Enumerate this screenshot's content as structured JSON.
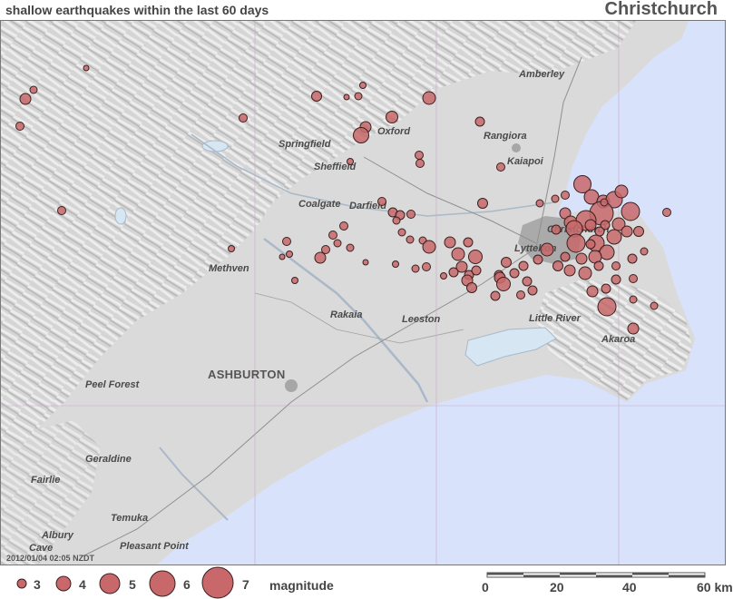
{
  "header": {
    "subtitle": "shallow earthquakes within the last 60 days",
    "title": "Christchurch"
  },
  "map": {
    "timestamp": "2012/01/04 02:05 NZDT",
    "colors": {
      "land": "#dadada",
      "sea": "#d8e2fa",
      "quake_fill": "#c8686b",
      "lake": "#d6e6f2"
    },
    "places": [
      {
        "name": "Amberley",
        "type": "town"
      },
      {
        "name": "Oxford",
        "type": "town"
      },
      {
        "name": "Springfield",
        "type": "town"
      },
      {
        "name": "Rangiora",
        "type": "town"
      },
      {
        "name": "Sheffield",
        "type": "town"
      },
      {
        "name": "Kaiapoi",
        "type": "town"
      },
      {
        "name": "Coalgate",
        "type": "town"
      },
      {
        "name": "Darfield",
        "type": "town"
      },
      {
        "name": "Christchurch",
        "type": "town"
      },
      {
        "name": "Lyttelton",
        "type": "town"
      },
      {
        "name": "Methven",
        "type": "town"
      },
      {
        "name": "Rakaia",
        "type": "town"
      },
      {
        "name": "Leeston",
        "type": "town"
      },
      {
        "name": "Little River",
        "type": "town"
      },
      {
        "name": "Akaroa",
        "type": "town"
      },
      {
        "name": "ASHBURTON",
        "type": "major"
      },
      {
        "name": "Peel Forest",
        "type": "town"
      },
      {
        "name": "Geraldine",
        "type": "town"
      },
      {
        "name": "Fairlie",
        "type": "town"
      },
      {
        "name": "Temuka",
        "type": "town"
      },
      {
        "name": "Albury",
        "type": "town"
      },
      {
        "name": "Cave",
        "type": "town"
      },
      {
        "name": "Pleasant Point",
        "type": "town"
      }
    ]
  },
  "legend": {
    "magnitudes": [
      "3",
      "4",
      "5",
      "6",
      "7"
    ],
    "label": "magnitude"
  },
  "scale_bar": {
    "ticks": [
      "0",
      "20",
      "40",
      "60 km"
    ]
  }
}
